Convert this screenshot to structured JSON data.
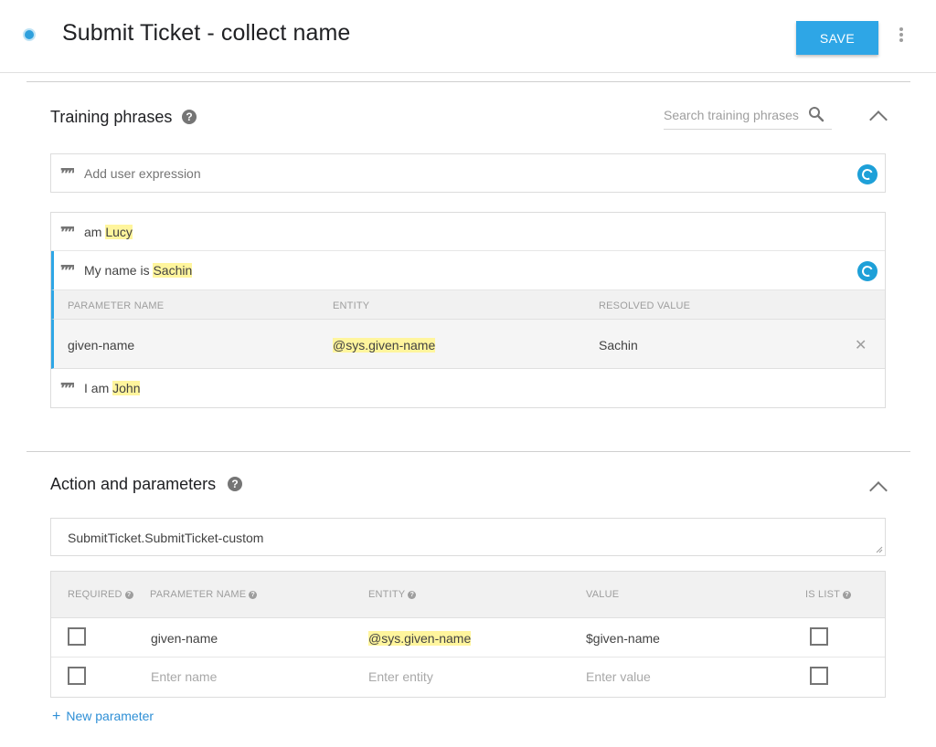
{
  "header": {
    "title": "Submit Ticket - collect name",
    "save_label": "SAVE"
  },
  "training": {
    "title": "Training phrases",
    "search_placeholder": "Search training phrases",
    "add_placeholder": "Add user expression",
    "phrases": [
      {
        "prefix": "am ",
        "entity": "Lucy"
      },
      {
        "prefix": "My name is ",
        "entity": "Sachin"
      },
      {
        "prefix": "I am ",
        "entity": "John"
      }
    ],
    "param_headers": {
      "name": "PARAMETER NAME",
      "entity": "ENTITY",
      "resolved": "RESOLVED VALUE"
    },
    "param_row": {
      "name": "given-name",
      "entity": "@sys.given-name",
      "resolved": "Sachin"
    }
  },
  "actions": {
    "title": "Action and parameters",
    "action_value": "SubmitTicket.SubmitTicket-custom",
    "headers": {
      "required": "REQUIRED",
      "param_name": "PARAMETER NAME",
      "entity": "ENTITY",
      "value": "VALUE",
      "is_list": "IS LIST"
    },
    "row": {
      "name": "given-name",
      "entity": "@sys.given-name",
      "value": "$given-name"
    },
    "empty_row": {
      "name_placeholder": "Enter name",
      "entity_placeholder": "Enter entity",
      "value_placeholder": "Enter value"
    },
    "new_parameter_label": "New parameter"
  },
  "colors": {
    "accent": "#2ea6e6",
    "highlight": "#fff59d"
  }
}
